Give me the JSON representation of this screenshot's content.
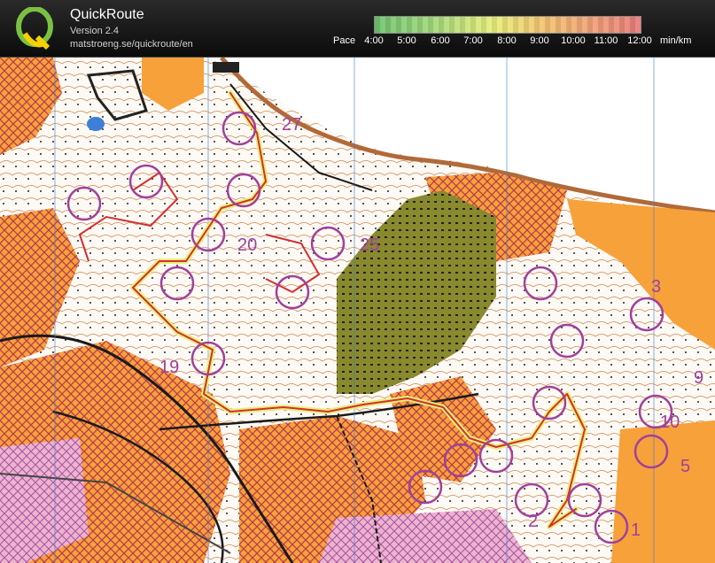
{
  "header": {
    "app_name": "QuickRoute",
    "version": "Version 2.4",
    "url": "matstroeng.se/quickroute/en",
    "logo_letter": "Q"
  },
  "pace_legend": {
    "label": "Pace",
    "ticks": [
      "4:00",
      "5:00",
      "6:00",
      "7:00",
      "8:00",
      "9:00",
      "10:00",
      "11:00",
      "12:00"
    ],
    "unit": "min/km",
    "colors": {
      "slow": "#e97a7a",
      "medium": "#e8ee7a",
      "fast": "#6ec46e"
    }
  },
  "map": {
    "control_numbers": [
      "27",
      "20",
      "25",
      "19",
      "3",
      "9",
      "10",
      "5",
      "2",
      "1"
    ],
    "colors": {
      "route": "#d23030",
      "control_circle": "#a0409c",
      "settlement": "#f7a13a",
      "forest_open": "#ffffff",
      "vegetation": "#8a8a2a",
      "water": "#3d7fd6"
    }
  }
}
